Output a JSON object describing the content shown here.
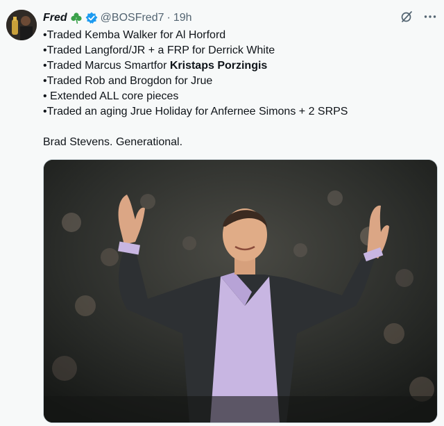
{
  "tweet": {
    "display_name": "Fred",
    "shamrock": "☘️",
    "handle": "@BOSFred7",
    "separator": "·",
    "timestamp": "19h",
    "lines": [
      "•Traded Kemba Walker for Al Horford",
      "•Traded Langford/JR + a FRP for Derrick White",
      "•Traded Marcus Smartfor ",
      "•Traded Rob and Brogdon for Jrue",
      "• Extended ALL core pieces",
      "•Traded an aging Jrue Holiday for Anfernee Simons + 2 SRPS"
    ],
    "bold_name": "Kristaps Porzingis",
    "closing": "Brad Stevens. Generational."
  },
  "icons": {
    "verified": "verified-badge-icon",
    "grok": "grok-icon",
    "more": "more-options-icon"
  },
  "colors": {
    "verified_blue": "#1d9bf0",
    "shamrock_green": "#3aa14a",
    "secondary_text": "#536471",
    "background": "#f7f9f9"
  }
}
